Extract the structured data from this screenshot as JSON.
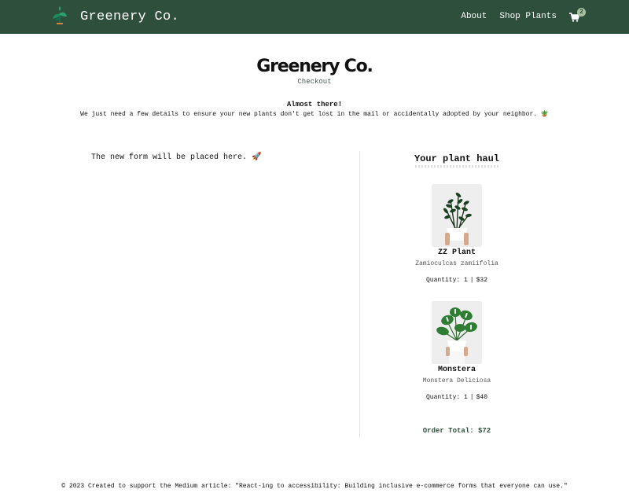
{
  "nav": {
    "brand": "Greenery Co.",
    "links": [
      "About",
      "Shop Plants"
    ],
    "cart_count": "2"
  },
  "header": {
    "title": "Greenery Co.",
    "subtitle": "Checkout",
    "intro_heading": "Almost there!",
    "intro_text": "We just need a few details to ensure your new plants don't get lost in the mail or accidentally adopted by your neighbor. 🪴"
  },
  "form_placeholder": "The new form will be placed here. 🚀",
  "haul": {
    "title": "Your plant haul",
    "items": [
      {
        "name": "ZZ Plant",
        "scientific": "Zamioculcas zamiifolia",
        "quantity_label": "Quantity: 1",
        "price": "$32"
      },
      {
        "name": "Monstera",
        "scientific": "Monstera Deliciosa",
        "quantity_label": "Quantity: 1",
        "price": "$40"
      }
    ],
    "order_total": "Order Total: $72"
  },
  "footer": {
    "text": "© 2023 Created to support the Medium article: \"React-ing to accessibility: Building inclusive e-commerce forms that everyone can use.\""
  },
  "colors": {
    "nav_bg": "#2f4f3d",
    "badge": "#a9c1a1",
    "accent": "#2f4f3d"
  },
  "icons": [
    "plant-logo-icon",
    "cart-icon"
  ]
}
